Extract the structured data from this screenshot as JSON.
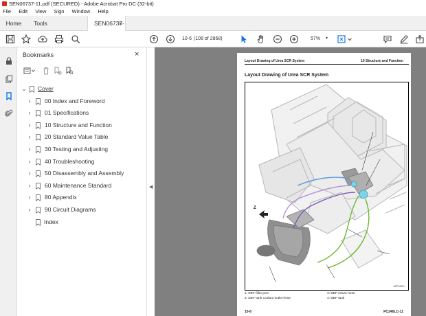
{
  "window": {
    "title": "SEN06737-11.pdf (SECURED) - Adobe Acrobat Pro DC (32-bit)"
  },
  "menu": [
    "File",
    "Edit",
    "View",
    "Sign",
    "Window",
    "Help"
  ],
  "tabs": {
    "home": "Home",
    "tools": "Tools",
    "document": "SEN06737-11.pdf (..."
  },
  "toolbar": {
    "page_current": "10-6",
    "page_total": "(108 of 2868)",
    "zoom": "57%",
    "icons": [
      "save-icon",
      "bookmark-star-icon",
      "upload-icon",
      "print-icon",
      "find-icon",
      "prev-page-icon",
      "next-page-icon",
      "select-cursor-icon",
      "hand-icon",
      "zoom-out-icon",
      "zoom-in-icon",
      "fit-page-icon",
      "comment-icon",
      "pen-icon",
      "share-icon"
    ]
  },
  "bookmarks": {
    "title": "Bookmarks",
    "items": [
      {
        "label": "Cover",
        "level": 0,
        "expander": "expanded"
      },
      {
        "label": "00 Index and Foreword",
        "level": 1,
        "expander": "collapsed"
      },
      {
        "label": "01 Specifications",
        "level": 1,
        "expander": "collapsed"
      },
      {
        "label": "10 Structure and Function",
        "level": 1,
        "expander": "collapsed"
      },
      {
        "label": "20 Standard Value Table",
        "level": 1,
        "expander": "collapsed"
      },
      {
        "label": "30 Testing and Adjusting",
        "level": 1,
        "expander": "collapsed"
      },
      {
        "label": "40 Troubleshooting",
        "level": 1,
        "expander": "collapsed"
      },
      {
        "label": "50 Disassembly and Assembly",
        "level": 1,
        "expander": "collapsed"
      },
      {
        "label": "60 Maintenance Standard",
        "level": 1,
        "expander": "collapsed"
      },
      {
        "label": "80 Appendix",
        "level": 1,
        "expander": "collapsed"
      },
      {
        "label": "90 Circuit Diagrams",
        "level": 1,
        "expander": "collapsed"
      },
      {
        "label": "Index",
        "level": 1,
        "expander": "none"
      }
    ]
  },
  "page": {
    "header_left": "Layout Drawing of Urea SCR System",
    "header_right": "10 Structure and Function",
    "title": "Layout Drawing of Urea SCR System",
    "figure_code": "AFP10301",
    "legend": [
      "1: DEF filler port",
      "3: DEF return hose",
      "2: DEF tank coolant outlet hose",
      "4: DEF tank"
    ],
    "footer_left": "10-6",
    "footer_right": "PC240LC-11"
  },
  "colors": {
    "accent_blue": "#1473e6",
    "acrobat_red": "#d62b1f",
    "viewer_bg": "#808080"
  }
}
